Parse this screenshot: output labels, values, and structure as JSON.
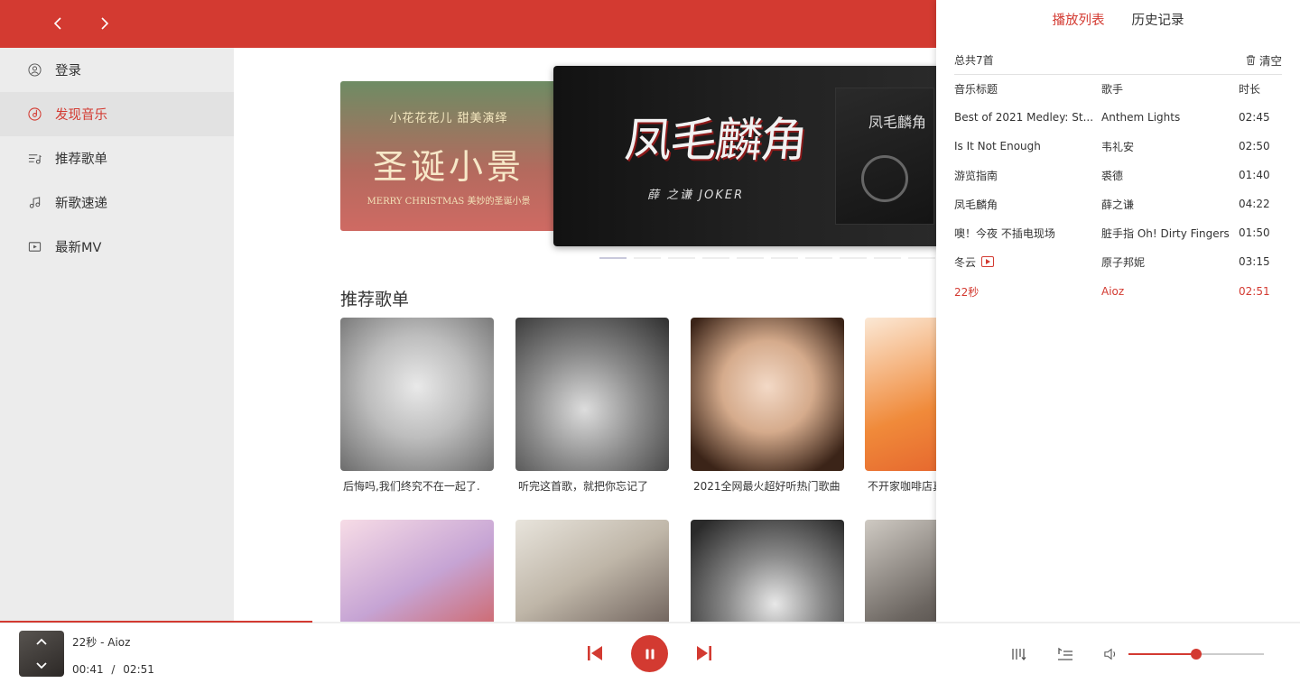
{
  "colors": {
    "accent": "#d33a31",
    "sidebar_bg": "#ececec",
    "sidebar_active_bg": "#e2e2e2"
  },
  "header": {
    "back_icon": "chevron-left-icon",
    "forward_icon": "chevron-right-icon"
  },
  "sidebar": {
    "items": [
      {
        "label": "登录",
        "icon": "user-icon",
        "active": false
      },
      {
        "label": "发现音乐",
        "icon": "music-disc-icon",
        "active": true
      },
      {
        "label": "推荐歌单",
        "icon": "playlist-icon",
        "active": false
      },
      {
        "label": "新歌速递",
        "icon": "music-note-icon",
        "active": false
      },
      {
        "label": "最新MV",
        "icon": "video-icon",
        "active": false
      }
    ]
  },
  "banners": {
    "left": {
      "line1": "小花花花儿  甜美演绎",
      "line2": "圣诞小景",
      "line3": "MERRY CHRISTMAS 美妙的圣诞小景"
    },
    "center": {
      "title": "凤毛麟角",
      "subtitle": "薛 之谦  JOKER",
      "cover_text": "凤毛麟角"
    },
    "dot_count": 10,
    "active_dot": 0
  },
  "recommend": {
    "title": "推荐歌单",
    "playlists": [
      {
        "name": "后悔吗,我们终究不在一起了."
      },
      {
        "name": "听完这首歌，就把你忘记了"
      },
      {
        "name": "2021全网最火超好听热门歌曲"
      },
      {
        "name": "不开家咖啡店真"
      },
      {
        "name": ""
      },
      {
        "name": ""
      },
      {
        "name": ""
      },
      {
        "name": ""
      }
    ]
  },
  "panel": {
    "tabs": [
      "播放列表",
      "历史记录"
    ],
    "active_tab": 0,
    "count_text": "总共7首",
    "clear_label": "清空",
    "columns": [
      "音乐标题",
      "歌手",
      "时长"
    ],
    "rows": [
      {
        "title": "Best of 2021 Medley: St...",
        "artist": "Anthem Lights",
        "duration": "02:45",
        "mv": false,
        "playing": false
      },
      {
        "title": "Is It Not Enough",
        "artist": "韦礼安",
        "duration": "02:50",
        "mv": false,
        "playing": false
      },
      {
        "title": "游览指南",
        "artist": "裘德",
        "duration": "01:40",
        "mv": false,
        "playing": false
      },
      {
        "title": "凤毛麟角",
        "artist": "薛之谦",
        "duration": "04:22",
        "mv": false,
        "playing": false
      },
      {
        "title": "噢！今夜 不插电现场",
        "artist": "脏手指 Oh! Dirty Fingers",
        "duration": "01:50",
        "mv": false,
        "playing": false
      },
      {
        "title": "冬云",
        "artist": "原子邦妮",
        "duration": "03:15",
        "mv": true,
        "playing": false
      },
      {
        "title": "22秒",
        "artist": "Aioz",
        "duration": "02:51",
        "mv": false,
        "playing": true
      }
    ]
  },
  "player": {
    "now_playing": "22秒  -  Aioz",
    "current_time": "00:41",
    "separator": "/",
    "total_time": "02:51",
    "progress": 0.24,
    "volume": 0.5
  }
}
